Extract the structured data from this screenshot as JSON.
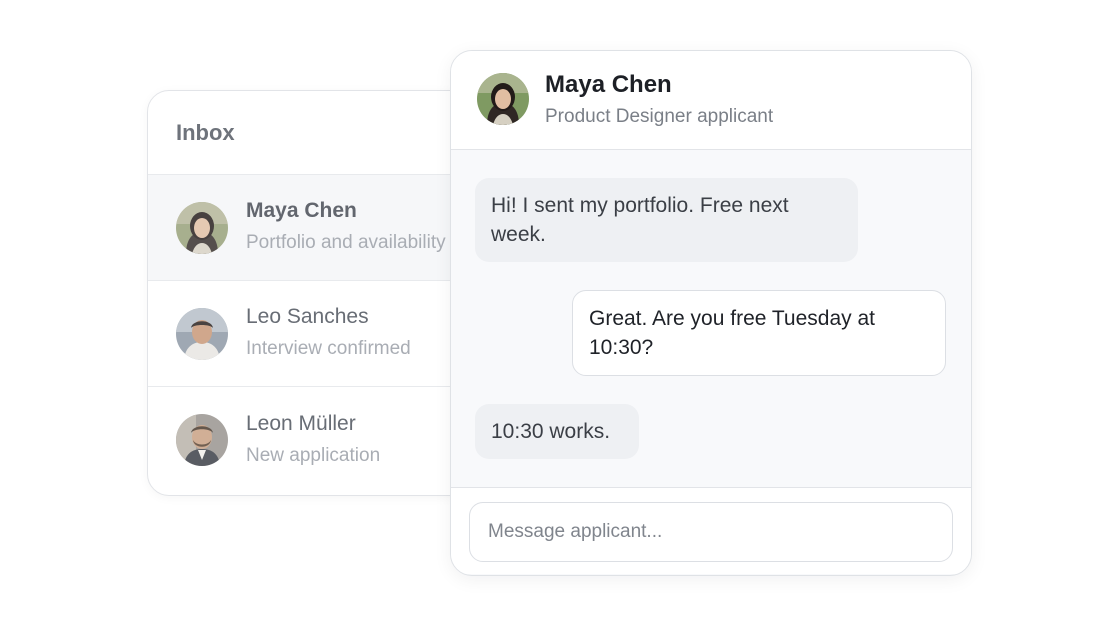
{
  "inbox": {
    "title": "Inbox",
    "conversations": [
      {
        "name": "Maya Chen",
        "preview": "Portfolio and availability",
        "active": true
      },
      {
        "name": "Leo Sanches",
        "preview": "Interview confirmed",
        "active": false
      },
      {
        "name": "Leon Müller",
        "preview": "New application",
        "active": false
      }
    ]
  },
  "chat": {
    "contact_name": "Maya Chen",
    "contact_role": "Product Designer applicant",
    "messages": [
      {
        "direction": "incoming",
        "text": "Hi! I sent my portfolio. Free next week."
      },
      {
        "direction": "outgoing",
        "text": "Great. Are you free Tuesday at 10:30?"
      },
      {
        "direction": "incoming",
        "text": "10:30 works."
      }
    ],
    "composer": {
      "placeholder": "Message applicant...",
      "value": ""
    }
  },
  "colors": {
    "panel_border": "#e2e4e8",
    "active_row_bg": "#f6f7f9",
    "incoming_bubble": "#eef0f3",
    "outgoing_bubble": "#ffffff",
    "chat_bg": "#f8f9fb"
  },
  "icons": {
    "avatar_maya": "woman-portrait-avatar",
    "avatar_leo": "man-portrait-avatar",
    "avatar_leon": "man-bearded-portrait-avatar"
  }
}
